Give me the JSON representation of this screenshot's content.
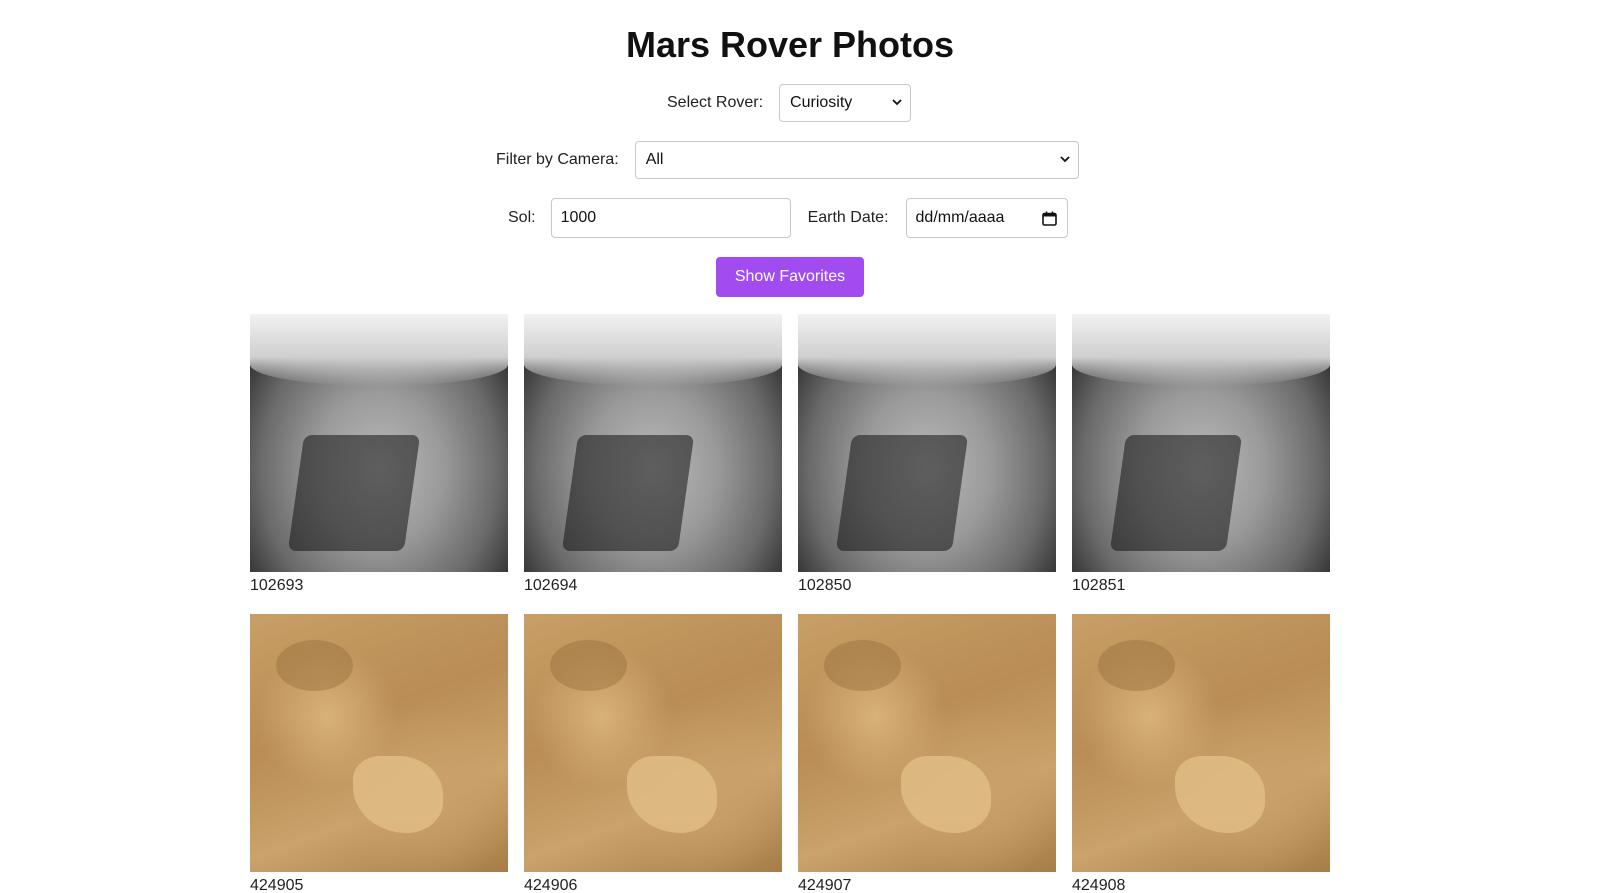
{
  "page": {
    "title": "Mars Rover Photos"
  },
  "controls": {
    "rover_label": "Select Rover:",
    "rover_value": "Curiosity",
    "camera_label": "Filter by Camera:",
    "camera_value": "All",
    "sol_label": "Sol:",
    "sol_value": "1000",
    "earth_date_label": "Earth Date:",
    "earth_date_placeholder": "dd/mm/aaaa",
    "favorites_button": "Show Favorites"
  },
  "colors": {
    "accent": "#a24cf0"
  },
  "photos": [
    {
      "id": "102693",
      "style": "gray"
    },
    {
      "id": "102694",
      "style": "gray"
    },
    {
      "id": "102850",
      "style": "gray"
    },
    {
      "id": "102851",
      "style": "gray"
    },
    {
      "id": "424905",
      "style": "tan"
    },
    {
      "id": "424906",
      "style": "tan"
    },
    {
      "id": "424907",
      "style": "tan"
    },
    {
      "id": "424908",
      "style": "tan"
    }
  ]
}
